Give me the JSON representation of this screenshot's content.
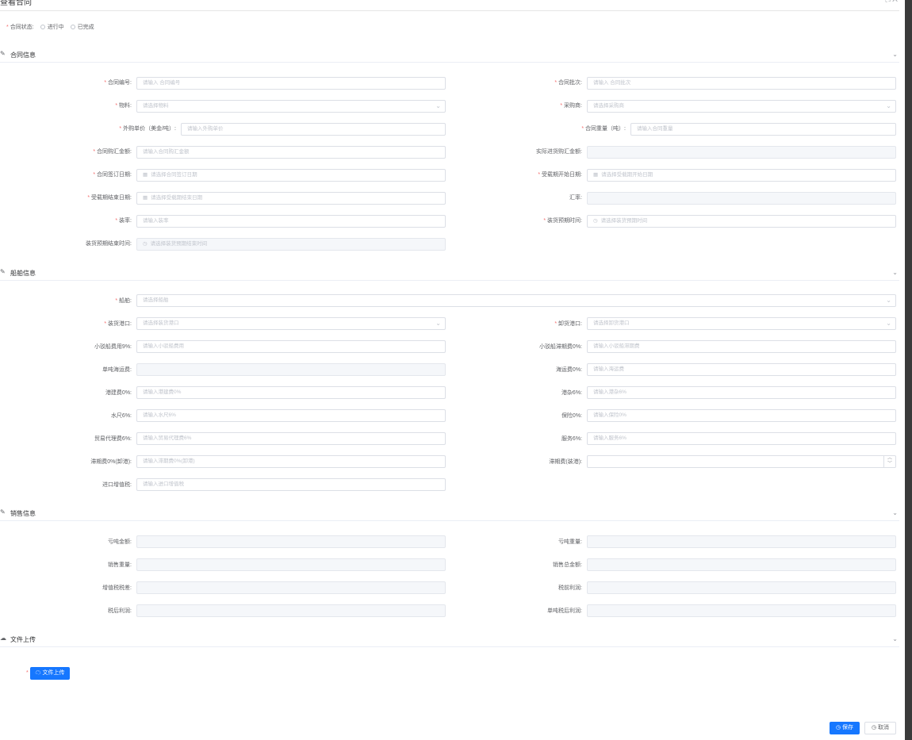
{
  "dialog": {
    "title": "查看合同",
    "controls": "⛶ ✕"
  },
  "status": {
    "label": "合同状态:",
    "options": [
      "进行中",
      "已完成"
    ]
  },
  "sections": {
    "contract": "合同信息",
    "ship": "船舶信息",
    "sales": "销售信息",
    "upload": "文件上传"
  },
  "contract": {
    "contract_no": {
      "label": "合同编号:",
      "placeholder": "请输入 合同编号"
    },
    "contract_batch": {
      "label": "合同批次:",
      "placeholder": "请输入 合同批次"
    },
    "material": {
      "label": "物料:",
      "placeholder": "请选择物料"
    },
    "purchaser": {
      "label": "采购商:",
      "placeholder": "请选择采购商"
    },
    "unit_price": {
      "label": "外购单价（美金/吨）:",
      "placeholder": "请输入外购单价"
    },
    "weight": {
      "label": "合同重量（吨）:",
      "placeholder": "请输入合同重量"
    },
    "total_amount": {
      "label": "合同购汇金额:",
      "placeholder": "请输入合同购汇金额"
    },
    "actual_amount": {
      "label": "实际进货购汇金额:",
      "placeholder": ""
    },
    "sign_date": {
      "label": "合同签订日期:",
      "placeholder": "请选择合同签订日期"
    },
    "charter_start": {
      "label": "受载期开始日期:",
      "placeholder": "请选择受载期开始日期"
    },
    "charter_end": {
      "label": "受载期结束日期:",
      "placeholder": "请选择受载期结束日期"
    },
    "exchange_rate": {
      "label": "汇率:",
      "placeholder": ""
    },
    "load_rate": {
      "label": "装率:",
      "placeholder": "请输入装率"
    },
    "load_expected": {
      "label": "装货预期时间:",
      "placeholder": "请选择装货预期时间"
    },
    "load_expected_end": {
      "label": "装货预期结束时间:",
      "placeholder": "请选择装货预期结束时间"
    }
  },
  "ship": {
    "vessel": {
      "label": "船舶:",
      "placeholder": "请选择船舶"
    },
    "load_port": {
      "label": "装货港口:",
      "placeholder": "请选择装货港口"
    },
    "unload_port": {
      "label": "卸货港口:",
      "placeholder": "请选择卸货港口"
    },
    "small_ship_fee": {
      "label": "小驳船费用9%:",
      "placeholder": "请输入小驳船费用"
    },
    "small_ship_demurrage": {
      "label": "小驳船滞期费0%:",
      "placeholder": "请输入小驳船滞期费"
    },
    "unit_freight": {
      "label": "单吨海运费:",
      "placeholder": ""
    },
    "freight": {
      "label": "海运费0%:",
      "placeholder": "请输入海运费"
    },
    "port_fee": {
      "label": "港建费0%:",
      "placeholder": "请输入港建费0%"
    },
    "port_misc": {
      "label": "港杂6%:",
      "placeholder": "请输入港杂6%"
    },
    "water_gauge": {
      "label": "水尺6%:",
      "placeholder": "请输入水尺6%"
    },
    "insurance": {
      "label": "保险0%:",
      "placeholder": "请输入保险0%"
    },
    "trade_agency": {
      "label": "贸易代理费6%:",
      "placeholder": "请输入贸易代理费6%"
    },
    "service": {
      "label": "服务6%:",
      "placeholder": "请输入服务6%"
    },
    "demurrage_unload": {
      "label": "滞期费0%(卸港):",
      "placeholder": "请输入滞期费0%(卸港)"
    },
    "demurrage_load": {
      "label": "滞期费(装港):",
      "placeholder": ""
    },
    "import_vat": {
      "label": "进口增值税:",
      "placeholder": "请输入进口增值税"
    }
  },
  "sales": {
    "loss_amount": {
      "label": "亏吨金额:"
    },
    "loss_weight": {
      "label": "亏吨重量:"
    },
    "sales_weight": {
      "label": "销售重量:"
    },
    "sales_total": {
      "label": "销售总金额:"
    },
    "vat_diff": {
      "label": "增值税税差:"
    },
    "pretax_profit": {
      "label": "税前利润:"
    },
    "aftertax_profit": {
      "label": "税后利润:"
    },
    "unit_aftertax_profit": {
      "label": "单吨税后利润:"
    }
  },
  "upload": {
    "button": "文件上传"
  },
  "footer": {
    "save": "保存",
    "cancel": "取消"
  },
  "icons": {
    "edit": "✎",
    "cloud": "☁",
    "calendar": "▦",
    "clock": "◷",
    "chevron": "⌄"
  }
}
